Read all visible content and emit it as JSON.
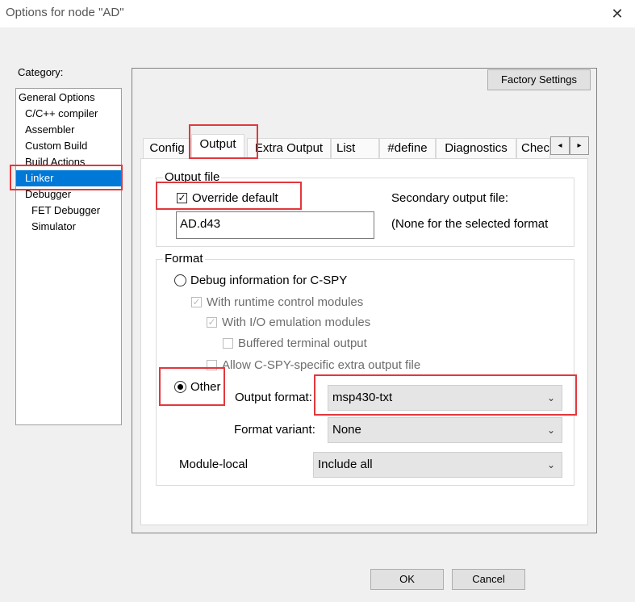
{
  "window": {
    "title": "Options for node \"AD\"",
    "close_glyph": "✕"
  },
  "category": {
    "label": "Category:",
    "items": [
      {
        "label": "General Options"
      },
      {
        "label": "C/C++ compiler"
      },
      {
        "label": "Assembler"
      },
      {
        "label": "Custom Build"
      },
      {
        "label": "Build Actions"
      },
      {
        "label": "Linker"
      },
      {
        "label": "Debugger"
      },
      {
        "label": "FET Debugger"
      },
      {
        "label": "Simulator"
      }
    ],
    "selected": "Linker"
  },
  "factory_settings_label": "Factory Settings",
  "tabs": [
    {
      "label": "Config"
    },
    {
      "label": "Output"
    },
    {
      "label": "Extra Output"
    },
    {
      "label": "List"
    },
    {
      "label": "#define"
    },
    {
      "label": "Diagnostics"
    },
    {
      "label": "Chec"
    }
  ],
  "active_tab": "Output",
  "tab_scroll": {
    "left": "◂",
    "right": "▸"
  },
  "output_file": {
    "group_label": "Output file",
    "override_label": "Override default",
    "override_checked": true,
    "filename_value": "AD.d43",
    "secondary_label": "Secondary output file:",
    "secondary_value": "(None for the selected format"
  },
  "format": {
    "group_label": "Format",
    "debug_info_label": "Debug information for C-SPY",
    "runtime_label": "With runtime control modules",
    "io_label": "With I/O emulation modules",
    "buffered_label": "Buffered terminal output",
    "allow_label": "Allow C-SPY-specific extra output file",
    "other_label": "Other",
    "other_selected": true,
    "output_format_label": "Output format:",
    "output_format_value": "msp430-txt",
    "format_variant_label": "Format variant:",
    "format_variant_value": "None",
    "module_local_label": "Module-local",
    "module_local_value": "Include all"
  },
  "buttons": {
    "ok": "OK",
    "cancel": "Cancel"
  },
  "check_glyph": "✓",
  "chevron_glyph": "⌄",
  "colors": {
    "selection": "#0078d7",
    "highlight": "#e3373c"
  }
}
